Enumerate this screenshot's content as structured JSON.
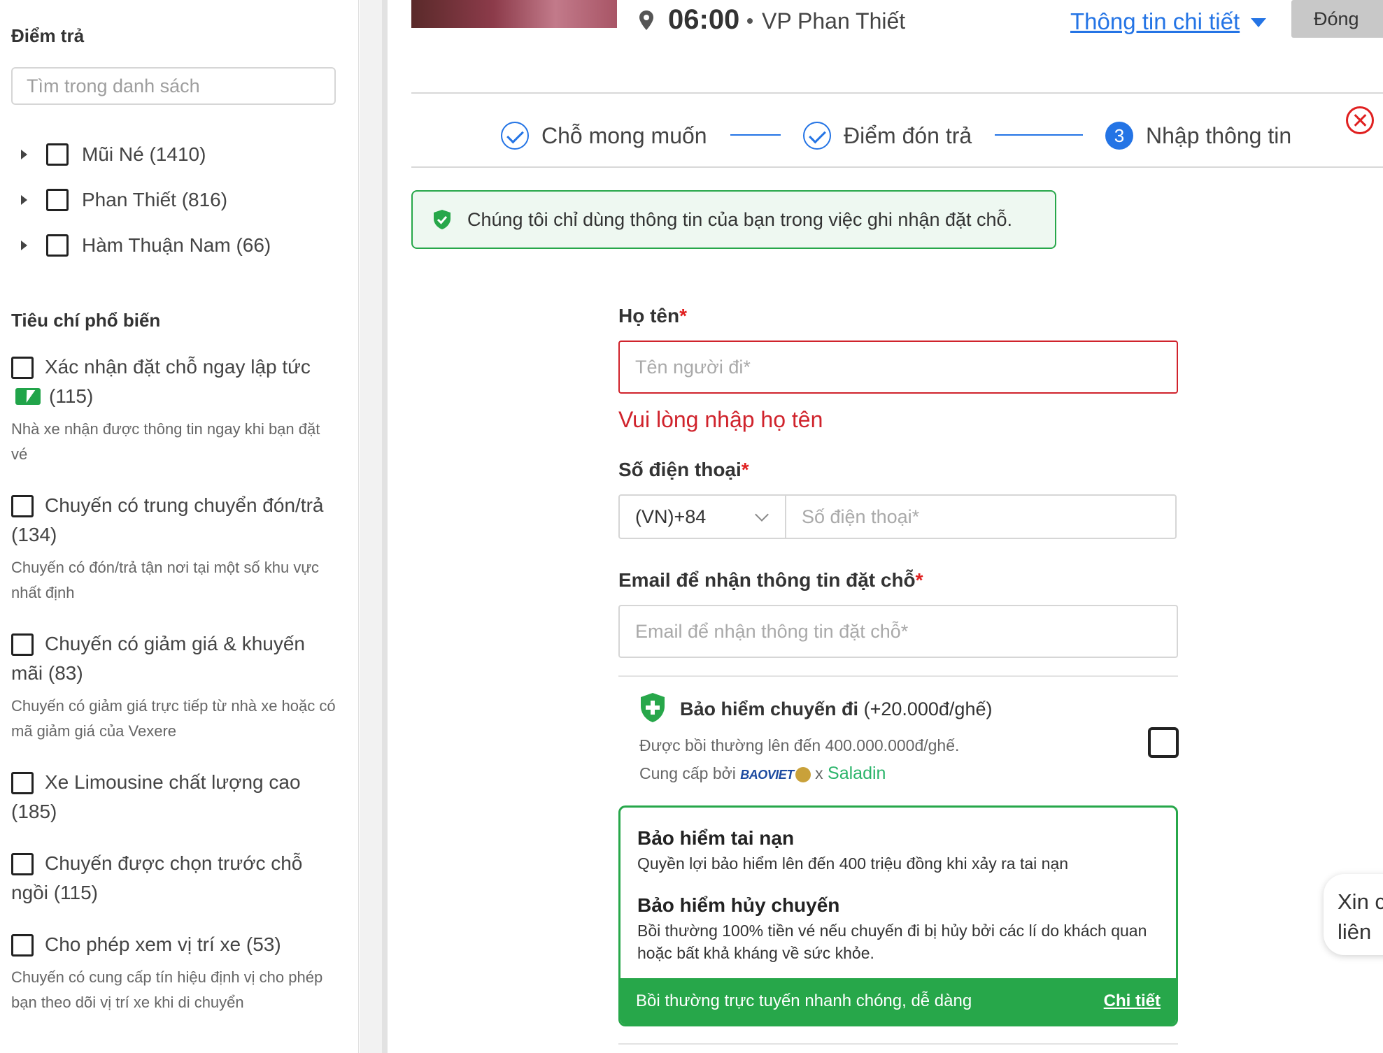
{
  "sidebar": {
    "dropoff_heading": "Điểm trả",
    "search_placeholder": "Tìm trong danh sách",
    "locations": [
      {
        "label": "Mũi Né (1410)"
      },
      {
        "label": "Phan Thiết (816)"
      },
      {
        "label": "Hàm Thuận Nam (66)"
      }
    ],
    "criteria_heading": "Tiêu chí phổ biến",
    "criteria": [
      {
        "line1": "Xác nhận đặt chỗ ngay lập tức",
        "line2": "(115)",
        "desc": "Nhà xe nhận được thông tin ngay khi bạn đặt vé"
      },
      {
        "line1": "Chuyến có trung chuyển đón/trả",
        "line2": "(134)",
        "desc": "Chuyến có đón/trả tận nơi tại một số khu vực nhất định"
      },
      {
        "line1": "Chuyến có giảm giá & khuyến",
        "line2": "mãi (83)",
        "desc": "Chuyến có giảm giá trực tiếp từ nhà xe hoặc có mã giảm giá của Vexere"
      },
      {
        "line1": "Xe Limousine chất lượng cao",
        "line2": "(185)",
        "desc": ""
      },
      {
        "line1": "Chuyến được chọn trước chỗ",
        "line2": "ngồi (115)",
        "desc": ""
      },
      {
        "line1": "Cho phép xem vị trí xe (53)",
        "line2": "",
        "desc": "Chuyến có cung cấp tín hiệu định vị cho phép bạn theo dõi vị trí xe khi di chuyển"
      }
    ]
  },
  "trip": {
    "time": "06:00",
    "station": "VP Phan Thiết",
    "detail_link": "Thông tin chi tiết",
    "close_label": "Đóng"
  },
  "steps": [
    {
      "label": "Chỗ mong muốn",
      "state": "done"
    },
    {
      "label": "Điểm đón trả",
      "state": "done"
    },
    {
      "label": "Nhập thông tin",
      "state": "current",
      "number": "3"
    }
  ],
  "notice": "Chúng tôi chỉ dùng thông tin của bạn trong việc ghi nhận đặt chỗ.",
  "form": {
    "name_label": "Họ tên",
    "name_placeholder": "Tên người đi*",
    "name_error": "Vui lòng nhập họ tên",
    "phone_label": "Số điện thoại",
    "country_code": "(VN)+84",
    "phone_placeholder": "Số điện thoại*",
    "email_label": "Email để nhận thông tin đặt chỗ",
    "email_placeholder": "Email để nhận thông tin đặt chỗ*",
    "required_mark": "*"
  },
  "insurance": {
    "title_bold": "Bảo hiểm chuyến đi",
    "title_price": "(+20.000đ/ghế)",
    "coverage": "Được bồi thường lên đến 400.000.000đ/ghế.",
    "provider_prefix": "Cung cấp bởi",
    "provider_1": "BAOVIET",
    "provider_sep": "x",
    "provider_2": "Saladin",
    "benefits": [
      {
        "title": "Bảo hiểm tai nạn",
        "desc": "Quyền lợi bảo hiểm lên đến 400 triệu đồng khi xảy ra tai nạn"
      },
      {
        "title": "Bảo hiểm hủy chuyến",
        "desc": "Bồi thường 100% tiền vé nếu chuyến đi bị hủy bởi các lí do khách quan hoặc bất khả kháng về sức khỏe."
      }
    ],
    "footer_text": "Bồi thường trực tuyến nhanh chóng, dễ dàng",
    "footer_link": "Chi tiết"
  },
  "chat": {
    "line1": "Xin c",
    "line2": "liên"
  },
  "colors": {
    "brand_blue": "#2474e5",
    "success_green": "#27a74a",
    "error_red": "#d0232c"
  }
}
